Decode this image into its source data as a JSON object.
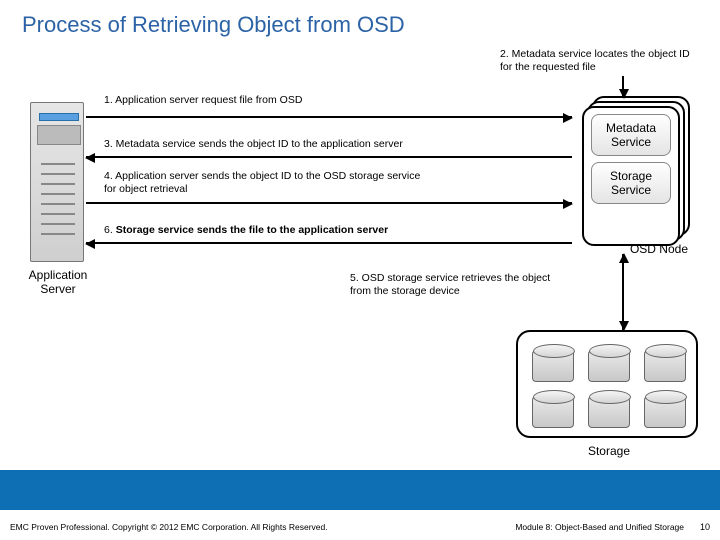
{
  "title": "Process of Retrieving Object from OSD",
  "steps": {
    "s1": "1. Application server request file from OSD",
    "s2": "2. Metadata service locates the object ID for the requested file",
    "s3": "3. Metadata service sends the object ID to the application server",
    "s4": "4. Application server sends the object ID to the OSD storage service for object retrieval",
    "s5": "5. OSD storage service retrieves the object from the storage device",
    "s6": "6. Storage service sends the file to the application server"
  },
  "labels": {
    "app_server": "Application Server",
    "metadata_service": "Metadata Service",
    "storage_service": "Storage Service",
    "osd_node": "OSD Node",
    "storage": "Storage"
  },
  "footer": {
    "left": "EMC Proven Professional. Copyright © 2012 EMC Corporation. All Rights Reserved.",
    "right": "Module 8: Object-Based and Unified Storage",
    "page": "10"
  },
  "colors": {
    "title": "#2b63a6",
    "footer_bar": "#0f6fb5"
  }
}
